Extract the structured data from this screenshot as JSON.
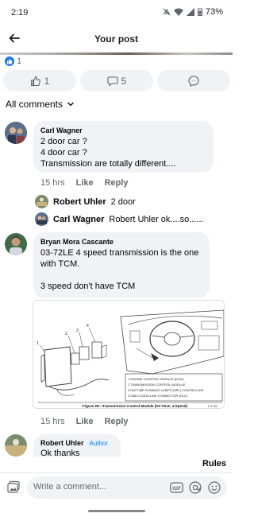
{
  "status": {
    "time": "2:19",
    "battery": "73%"
  },
  "header": {
    "title": "Your post"
  },
  "reactions": {
    "count": "1"
  },
  "actions": {
    "like_count": "1",
    "comment_count": "5"
  },
  "filter": {
    "label": "All comments"
  },
  "comments": [
    {
      "name": "Carl Wagner",
      "lines": [
        "2 door car ?",
        "4 door car ?",
        "Transmission are totally different...."
      ],
      "time": "15 hrs",
      "like": "Like",
      "reply": "Reply"
    },
    {
      "name": "Bryan Mora Cascante",
      "lines": [
        "03-72LE 4 speed transmission is the one",
        "with TCM.",
        "3 speed don't have TCM"
      ],
      "time": "15 hrs",
      "like": "Like",
      "reply": "Reply"
    },
    {
      "name": "Robert Uhler",
      "badge": "Author",
      "lines": [
        "Ok thanks"
      ]
    }
  ],
  "replies": [
    {
      "name": "Robert Uhler",
      "text": "2 door"
    },
    {
      "name": "Carl Wagner",
      "text": "Robert Uhler ok....so......"
    }
  ],
  "diagram": {
    "caption": "Figure 29—Transmission Control Module (03-72LE, 4-Speed)",
    "legend": [
      "1  ENGINE CONTROL MODULE (ECM)",
      "2  TRANSMISSION CONTROL MODULE",
      "3  DAYTIME RUNNING LAMPS (DRL) CONTROLLER",
      "4  OBD-II DATA LINK CONNECTOR (DLC)"
    ],
    "callouts": [
      "1",
      "2",
      "3",
      "4"
    ],
    "code": "F-4735"
  },
  "footer": {
    "rules": "Rules",
    "composer_placeholder": "Write a comment..."
  },
  "icons": {
    "back": "arrow-left-icon",
    "like": "thumbs-up-icon",
    "comment": "speech-bubble-icon",
    "messenger": "messenger-icon",
    "chevron": "chevron-down-icon",
    "photo": "photo-icon",
    "gif": "gif-icon",
    "mention": "at-icon",
    "emoji": "smiley-icon"
  },
  "colors": {
    "accent": "#1877f2",
    "bubble": "#f0f2f5",
    "muted": "#65676b"
  }
}
